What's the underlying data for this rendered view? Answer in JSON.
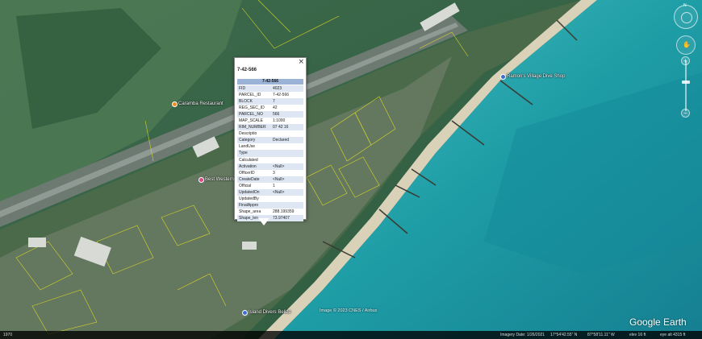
{
  "popup": {
    "close_glyph": "×",
    "title": "7-42-566",
    "header": "7-42-566",
    "rows": [
      {
        "k": "FID",
        "v": "4023"
      },
      {
        "k": "PARCEL_ID",
        "v": "7-42-566"
      },
      {
        "k": "BLOCK",
        "v": "7"
      },
      {
        "k": "REG_SEC_ID",
        "v": "42"
      },
      {
        "k": "PARCEL_NO",
        "v": "566"
      },
      {
        "k": "MAP_SCALE",
        "v": "1:1000"
      },
      {
        "k": "RIM_NUMBER",
        "v": "07 42 16"
      },
      {
        "k": "Descriptio",
        "v": ""
      },
      {
        "k": "Category",
        "v": "Declared"
      },
      {
        "k": "LandUse",
        "v": ""
      },
      {
        "k": "Type",
        "v": ""
      },
      {
        "k": "Calculated",
        "v": ""
      },
      {
        "k": "Activation",
        "v": "<Null>"
      },
      {
        "k": "OfficerID",
        "v": "3"
      },
      {
        "k": "CreateDate",
        "v": "<Null>"
      },
      {
        "k": "Official",
        "v": "1"
      },
      {
        "k": "UpdatedOn",
        "v": "<Null>"
      },
      {
        "k": "UpdatedBy",
        "v": ""
      },
      {
        "k": "FinalAppro",
        "v": ""
      },
      {
        "k": "Shape_area",
        "v": "288.199359"
      },
      {
        "k": "Shape_len",
        "v": "73.97407"
      }
    ]
  },
  "places": [
    {
      "name": "Ramon's Village Dive Shop",
      "pin": "blue"
    },
    {
      "name": "Island Divers Belize",
      "pin": "blue"
    },
    {
      "name": "Best Western",
      "pin": "pink"
    },
    {
      "name": "Caramba Restaurant",
      "pin": "orange"
    }
  ],
  "status": {
    "left_text": "1970",
    "imagery_date": "Imagery Date: 1/26/2021",
    "lat": "17°54'42.55\" N",
    "lon": "87°58'11.11\" W",
    "elev": "elev   16 ft",
    "eye_alt": "eye alt   4315 ft"
  },
  "credit": "Image © 2023 CNES / Airbus",
  "logo": "Google Earth",
  "nav": {
    "north": "N",
    "zoom_in": "+",
    "zoom_out": "−",
    "move_glyph": "✋"
  },
  "colors": {
    "sea": "#1fa3a6",
    "land": "#3a6a44",
    "parcel_lines": "#e6e020"
  }
}
